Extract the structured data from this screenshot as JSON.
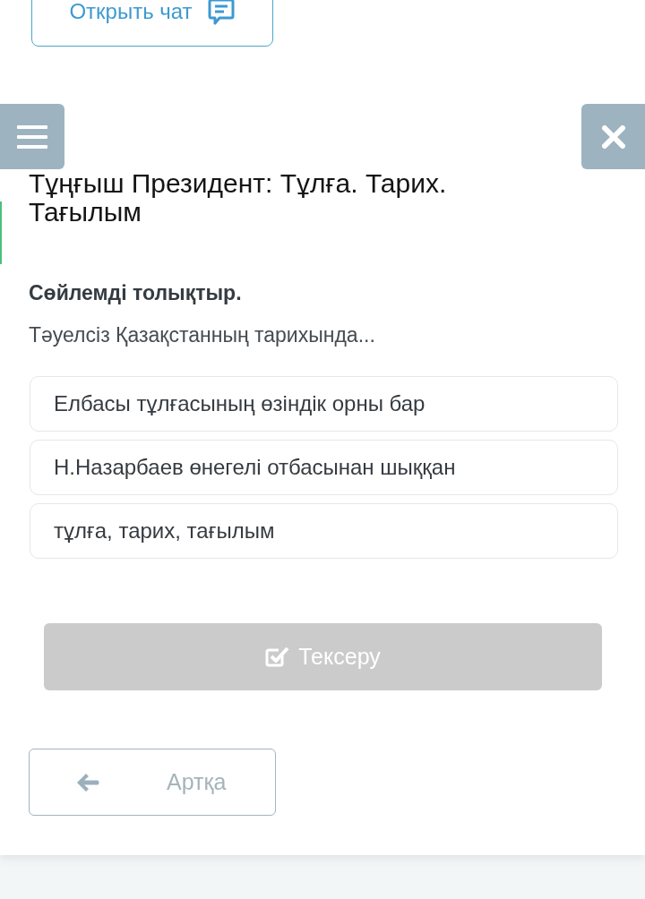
{
  "chat_button": {
    "label": "Открыть чат"
  },
  "title": "Тұңғыш Президент: Тұлға. Тарих. Тағылым",
  "task": {
    "instruction": "Сөйлемді толықтыр.",
    "prompt": "Тәуелсіз Қазақстанның тарихында..."
  },
  "options": [
    {
      "text": "Елбасы тұлғасының өзіндік орны бар",
      "selected": false
    },
    {
      "text": "Н.Назарбаев өнегелі отбасынан шыққан",
      "selected": false
    },
    {
      "text": "тұлға, тарих, тағылым",
      "selected": false
    }
  ],
  "check_button": {
    "label": "Тексеру",
    "disabled": true
  },
  "back_button": {
    "label": "Артқа"
  }
}
